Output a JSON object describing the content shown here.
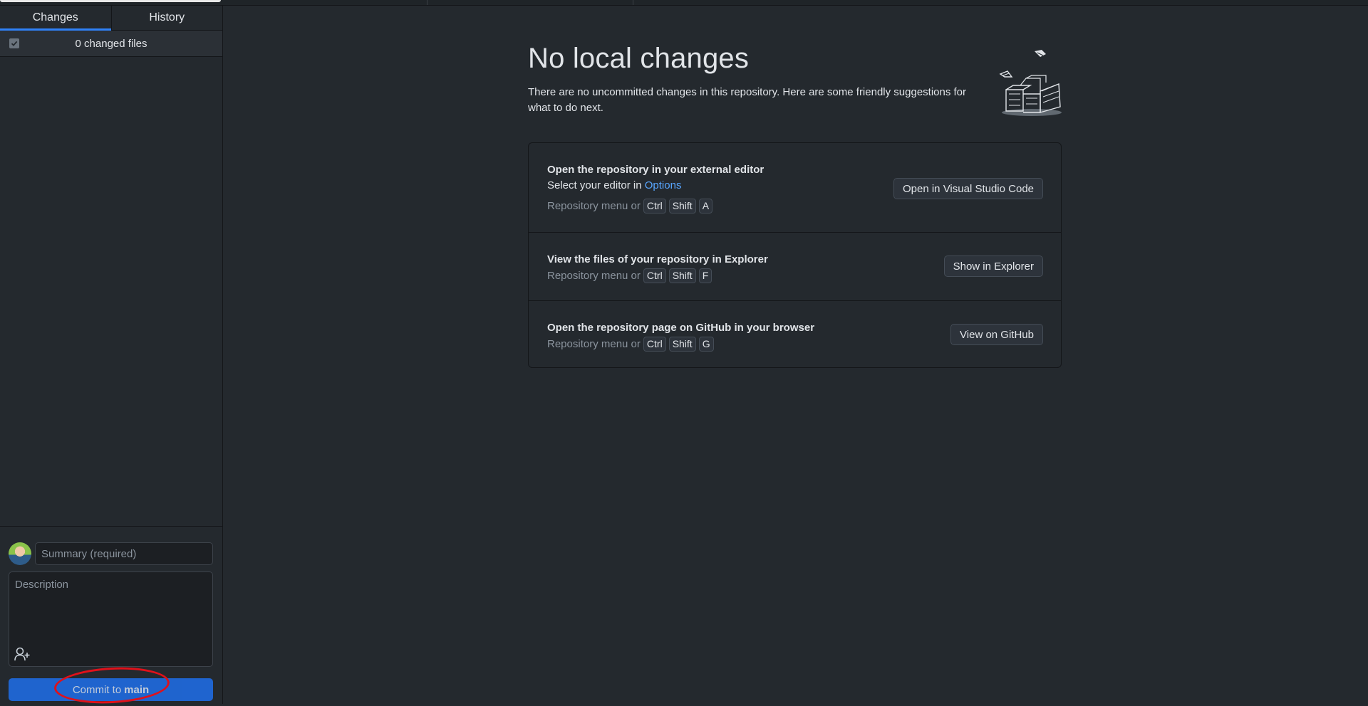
{
  "sidebar": {
    "tabs": [
      {
        "label": "Changes"
      },
      {
        "label": "History"
      }
    ],
    "files_count": "0 changed files"
  },
  "commit": {
    "summary_placeholder": "Summary (required)",
    "description_placeholder": "Description",
    "button_prefix": "Commit to",
    "branch": "main"
  },
  "main": {
    "title": "No local changes",
    "subtitle": "There are no uncommitted changes in this repository. Here are some friendly suggestions for what to do next.",
    "suggestions": [
      {
        "heading": "Open the repository in your external editor",
        "line2_prefix": "Select your editor in",
        "line2_link": "Options",
        "shortcut_prefix": "Repository menu or",
        "keys": [
          "Ctrl",
          "Shift",
          "A"
        ],
        "button": "Open in Visual Studio Code"
      },
      {
        "heading": "View the files of your repository in Explorer",
        "shortcut_prefix": "Repository menu or",
        "keys": [
          "Ctrl",
          "Shift",
          "F"
        ],
        "button": "Show in Explorer"
      },
      {
        "heading": "Open the repository page on GitHub in your browser",
        "shortcut_prefix": "Repository menu or",
        "keys": [
          "Ctrl",
          "Shift",
          "G"
        ],
        "button": "View on GitHub"
      }
    ]
  },
  "colors": {
    "background": "#24292e",
    "accent": "#1f6feb",
    "link": "#58a6ff",
    "annotation": "#e0111a"
  }
}
